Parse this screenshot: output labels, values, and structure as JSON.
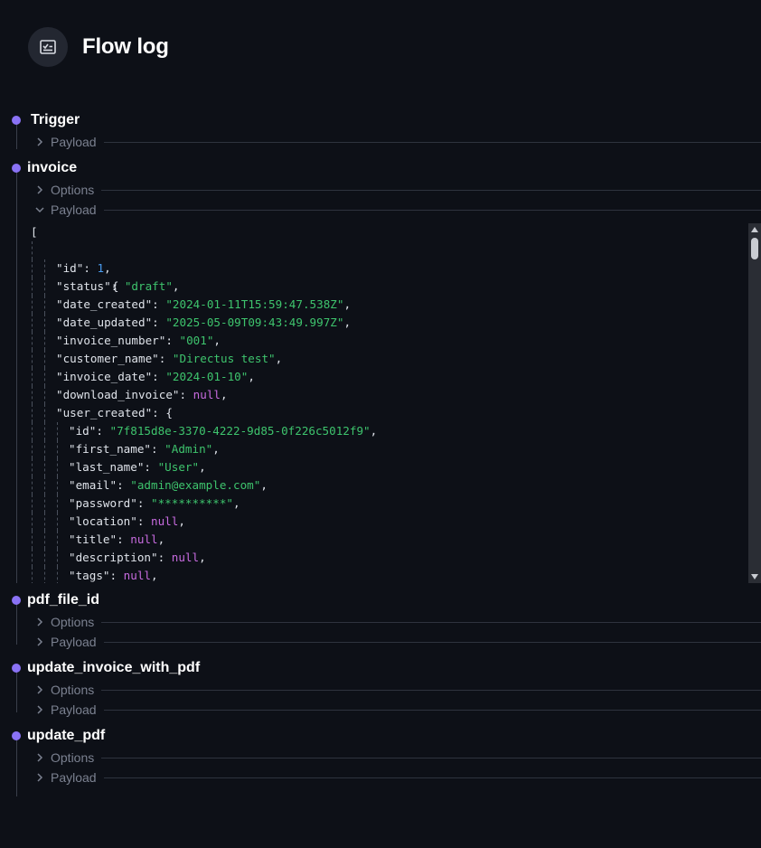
{
  "header": {
    "title": "Flow log",
    "icon": "checklist-icon"
  },
  "steps": [
    {
      "name": "Trigger",
      "subs": [
        "Payload"
      ]
    },
    {
      "name": "invoice",
      "subs": [
        "Options",
        "Payload"
      ]
    },
    {
      "name": "pdf_file_id",
      "subs": [
        "Options",
        "Payload"
      ]
    },
    {
      "name": "update_invoice_with_pdf",
      "subs": [
        "Options",
        "Payload"
      ]
    },
    {
      "name": "update_pdf",
      "subs": [
        "Options",
        "Payload"
      ]
    }
  ],
  "payload": {
    "open_bracket": "[",
    "open_brace": "{",
    "fields": [
      {
        "key": "\"id\"",
        "value": "1",
        "type": "n"
      },
      {
        "key": "\"status\"",
        "value": "\"draft\"",
        "type": "s"
      },
      {
        "key": "\"date_created\"",
        "value": "\"2024-01-11T15:59:47.538Z\"",
        "type": "s"
      },
      {
        "key": "\"date_updated\"",
        "value": "\"2025-05-09T09:43:49.997Z\"",
        "type": "s"
      },
      {
        "key": "\"invoice_number\"",
        "value": "\"001\"",
        "type": "s"
      },
      {
        "key": "\"customer_name\"",
        "value": "\"Directus test\"",
        "type": "s"
      },
      {
        "key": "\"invoice_date\"",
        "value": "\"2024-01-10\"",
        "type": "s"
      },
      {
        "key": "\"download_invoice\"",
        "value": "null",
        "type": "nl"
      },
      {
        "key": "\"user_created\"",
        "value": "{",
        "type": "p"
      }
    ],
    "user_fields": [
      {
        "key": "\"id\"",
        "value": "\"7f815d8e-3370-4222-9d85-0f226c5012f9\"",
        "type": "s"
      },
      {
        "key": "\"first_name\"",
        "value": "\"Admin\"",
        "type": "s"
      },
      {
        "key": "\"last_name\"",
        "value": "\"User\"",
        "type": "s"
      },
      {
        "key": "\"email\"",
        "value": "\"admin@example.com\"",
        "type": "s"
      },
      {
        "key": "\"password\"",
        "value": "\"**********\"",
        "type": "s"
      },
      {
        "key": "\"location\"",
        "value": "null",
        "type": "nl"
      },
      {
        "key": "\"title\"",
        "value": "null",
        "type": "nl"
      },
      {
        "key": "\"description\"",
        "value": "null",
        "type": "nl"
      },
      {
        "key": "\"tags\"",
        "value": "null",
        "type": "nl"
      }
    ]
  }
}
